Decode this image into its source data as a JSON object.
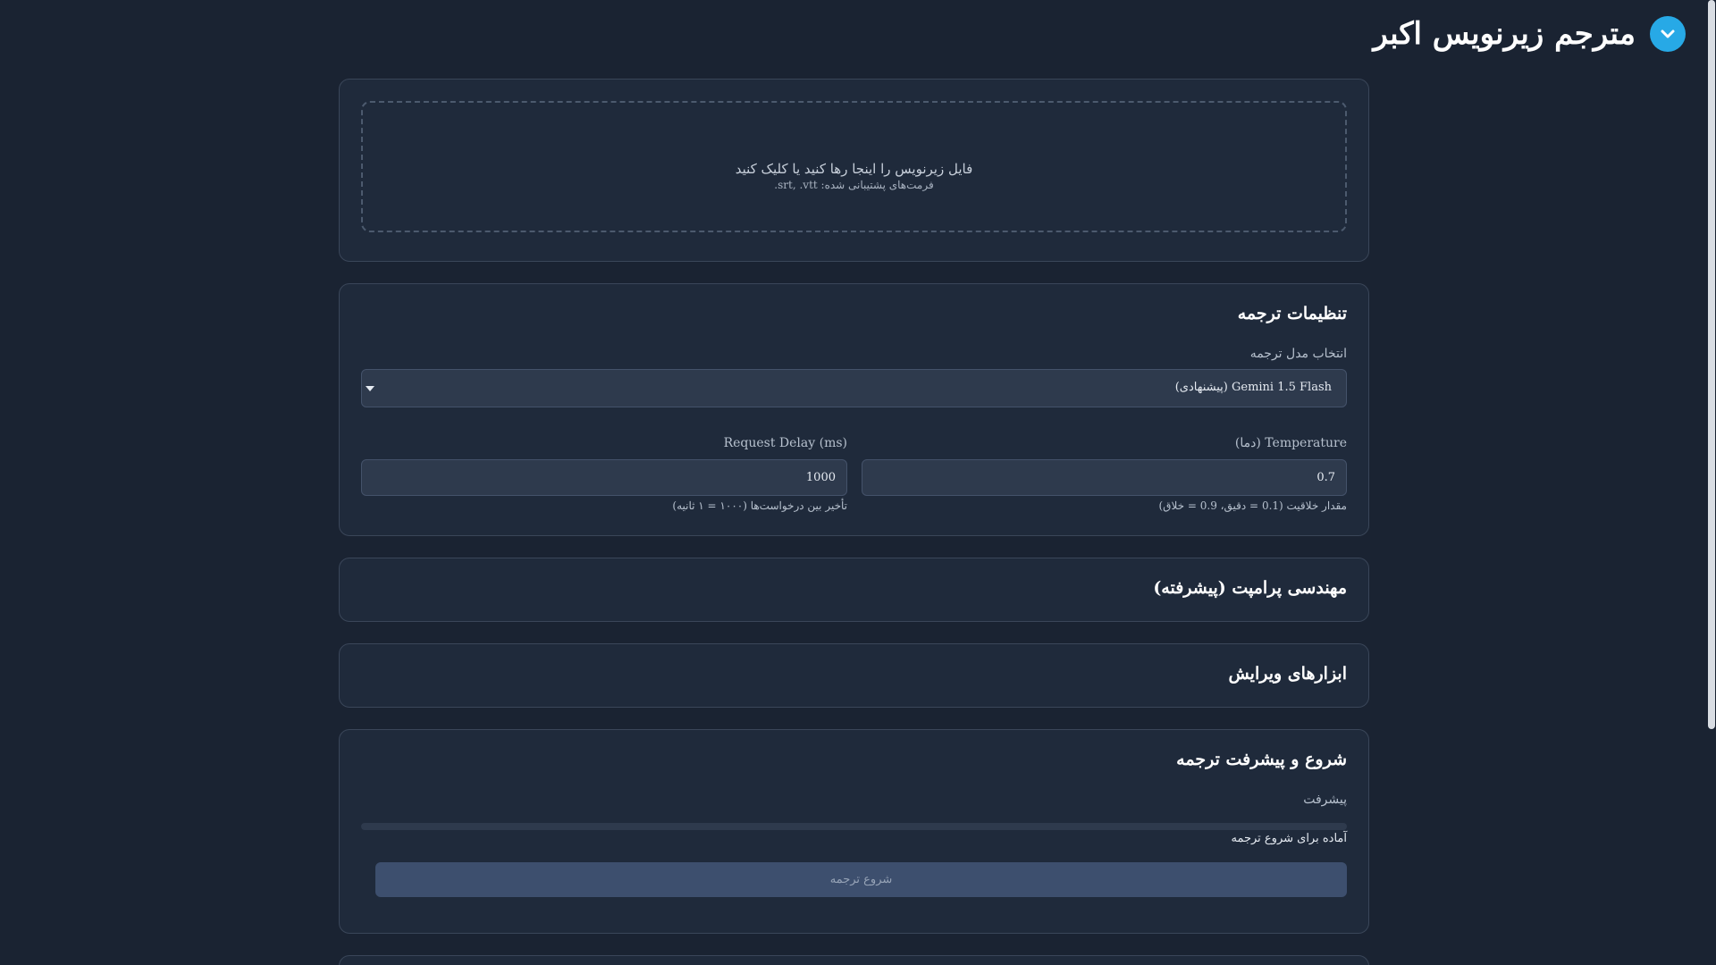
{
  "header": {
    "title": "مترجم زیرنویس اکبر",
    "logo_icon": "chevron-down-icon",
    "logo_color": "#27a9e6"
  },
  "upload": {
    "main_text": "فایل زیرنویس را اینجا رها کنید یا کلیک کنید",
    "formats_text": "فرمت‌های پشتیبانی شده: srt, .vtt."
  },
  "settings": {
    "title": "تنظیمات ترجمه",
    "model_label": "انتخاب مدل ترجمه",
    "model_value": "Gemini 1.5 Flash (پیشنهادی)",
    "temperature_label": "Temperature (دما)",
    "temperature_value": "0.7",
    "temperature_hint": "مقدار خلاقیت (0.1 = دقیق، 0.9 = خلاق)",
    "delay_label": "Request Delay (ms)",
    "delay_value": "1000",
    "delay_hint": "تأخیر بین درخواست‌ها (۱۰۰۰ = ۱ ثانیه)"
  },
  "prompt_engineering": {
    "title": "مهندسی پرامپت (پیشرفته)"
  },
  "edit_tools": {
    "title": "ابزارهای ویرایش"
  },
  "progress": {
    "title": "شروع و پیشرفت ترجمه",
    "label": "پیشرفت",
    "percent": 0,
    "status": "آماده برای شروع ترجمه",
    "start_label": "شروع ترجمه"
  }
}
